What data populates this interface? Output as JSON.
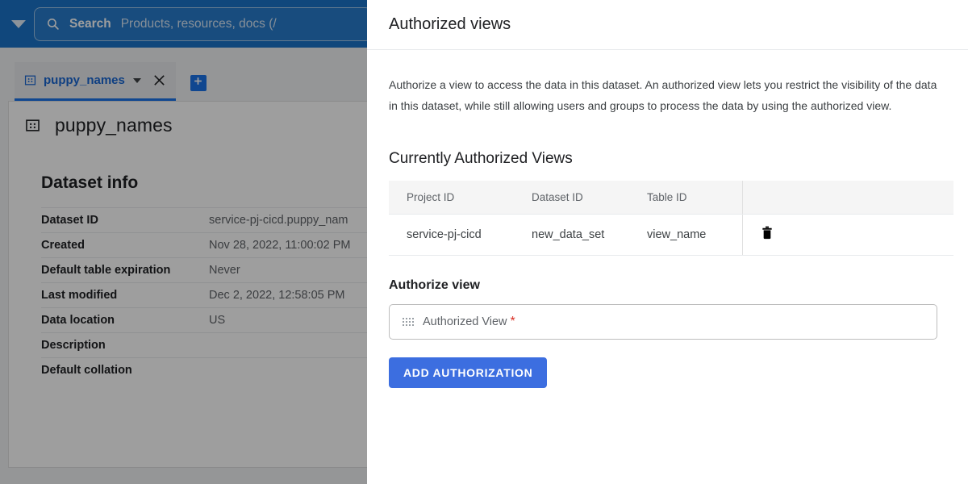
{
  "topbar": {
    "menu_caret_icon": "chevron-down-icon",
    "search_icon": "search-icon",
    "search_label": "Search",
    "search_placeholder": "Products, resources, docs (/"
  },
  "tabs": {
    "active_tab": {
      "icon": "dataset-grid-icon",
      "label": "puppy_names",
      "caret_icon": "caret-down-icon",
      "close_icon": "close-icon"
    },
    "add_tab_icon": "plus-icon"
  },
  "page": {
    "title_icon": "dataset-grid-icon",
    "title": "puppy_names",
    "dataset_info": {
      "heading": "Dataset info",
      "rows": [
        {
          "key": "Dataset ID",
          "value": "service-pj-cicd.puppy_nam"
        },
        {
          "key": "Created",
          "value": "Nov 28, 2022, 11:00:02 PM"
        },
        {
          "key": "Default table expiration",
          "value": "Never"
        },
        {
          "key": "Last modified",
          "value": "Dec 2, 2022, 12:58:05 PM"
        },
        {
          "key": "Data location",
          "value": "US"
        },
        {
          "key": "Description",
          "value": ""
        },
        {
          "key": "Default collation",
          "value": ""
        }
      ]
    }
  },
  "dialog": {
    "title": "Authorized views",
    "description": "Authorize a view to access the data in this dataset. An authorized view lets you restrict the visibility of the data in this dataset, while still allowing users and groups to process the data by using the authorized view.",
    "current_views": {
      "heading": "Currently Authorized Views",
      "columns": [
        "Project ID",
        "Dataset ID",
        "Table ID",
        ""
      ],
      "rows": [
        {
          "project_id": "service-pj-cicd",
          "dataset_id": "new_data_set",
          "table_id": "view_name",
          "delete_icon": "trash-icon"
        }
      ]
    },
    "authorize_form": {
      "heading": "Authorize view",
      "input_icon": "dot-grid-icon",
      "input_placeholder": "Authorized View",
      "required_marker": "*",
      "input_value": "",
      "submit_label": "ADD AUTHORIZATION"
    }
  },
  "colors": {
    "topbar_blue": "#1a73c8",
    "accent_blue": "#1a73e8",
    "button_blue": "#3c6ee0",
    "required_red": "#d93025",
    "header_row_grey": "#f5f5f5"
  }
}
